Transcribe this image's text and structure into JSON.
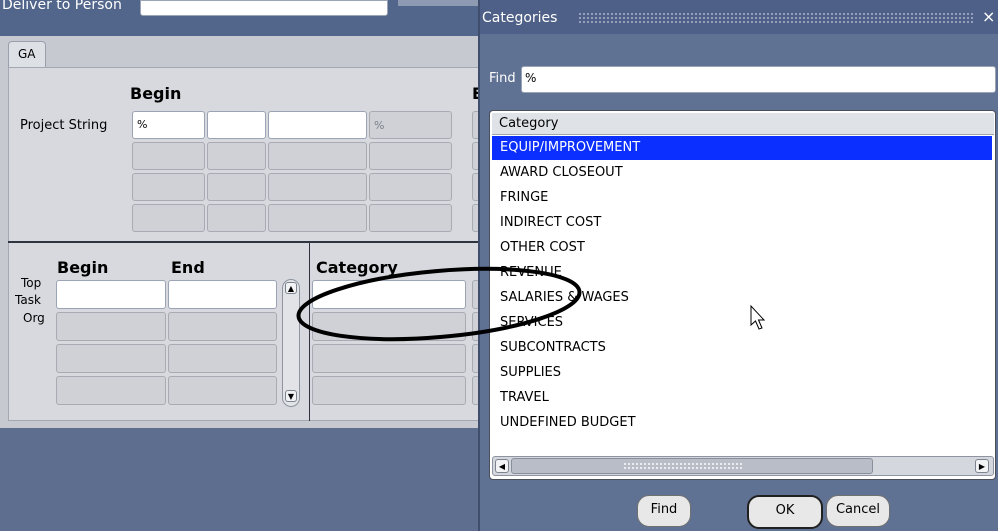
{
  "background_form": {
    "deliver_label": "Deliver to Person",
    "tab_label": "GA",
    "project_begin_heading": "Begin",
    "project_string_label": "Project String",
    "project_string_value": "%",
    "segment4_value": "%",
    "task_begin_heading": "Begin",
    "task_end_heading": "End",
    "category_heading": "Category",
    "row_labels": [
      "Top",
      "Task",
      "Org"
    ]
  },
  "dialog": {
    "title": "Categories",
    "close_glyph": "×",
    "find_label": "Find",
    "find_value": "%",
    "column_header": "Category",
    "items": [
      "EQUIP/IMPROVEMENT",
      "AWARD CLOSEOUT",
      "FRINGE",
      "INDIRECT COST",
      "OTHER COST",
      "REVENUE",
      "SALARIES & WAGES",
      "SERVICES",
      "SUBCONTRACTS",
      "SUPPLIES",
      "TRAVEL",
      "UNDEFINED BUDGET"
    ],
    "selected_index": 0,
    "buttons": {
      "find": "Find",
      "ok": "OK",
      "cancel": "Cancel"
    }
  },
  "colors": {
    "header_blue": "#52658a",
    "form_gray": "#c6c9d0",
    "footer_blue": "#5d6e8e",
    "dialog_blue": "#607294",
    "selection_blue": "#0a2fff",
    "annotation_ellipse": "#000000"
  }
}
